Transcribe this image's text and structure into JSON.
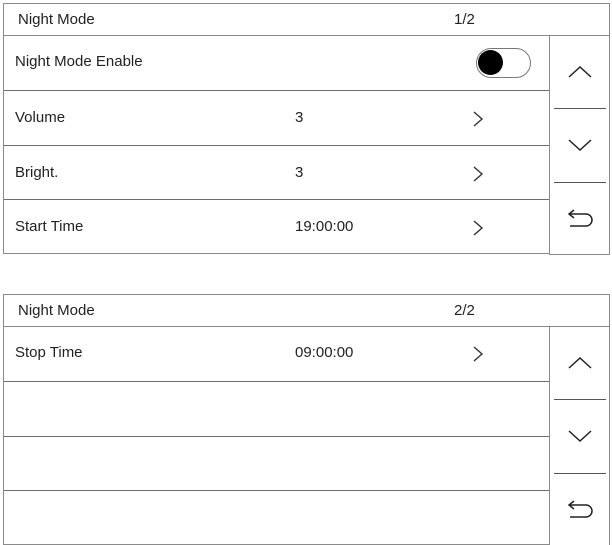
{
  "screens": [
    {
      "title": "Night Mode",
      "page": "1/2",
      "rows": [
        {
          "label": "Night Mode Enable",
          "type": "toggle",
          "enabled": true
        },
        {
          "label": "Volume",
          "value": "3",
          "type": "nav"
        },
        {
          "label": "Bright.",
          "value": "3",
          "type": "nav"
        },
        {
          "label": "Start Time",
          "value": "19:00:00",
          "type": "nav"
        }
      ]
    },
    {
      "title": "Night Mode",
      "page": "2/2",
      "rows": [
        {
          "label": "Stop Time",
          "value": "09:00:00",
          "type": "nav"
        },
        {
          "label": "",
          "type": "empty"
        },
        {
          "label": "",
          "type": "empty"
        },
        {
          "label": "",
          "type": "empty"
        }
      ]
    }
  ],
  "side_buttons": [
    "chevron-up-icon",
    "chevron-down-icon",
    "return-icon"
  ]
}
